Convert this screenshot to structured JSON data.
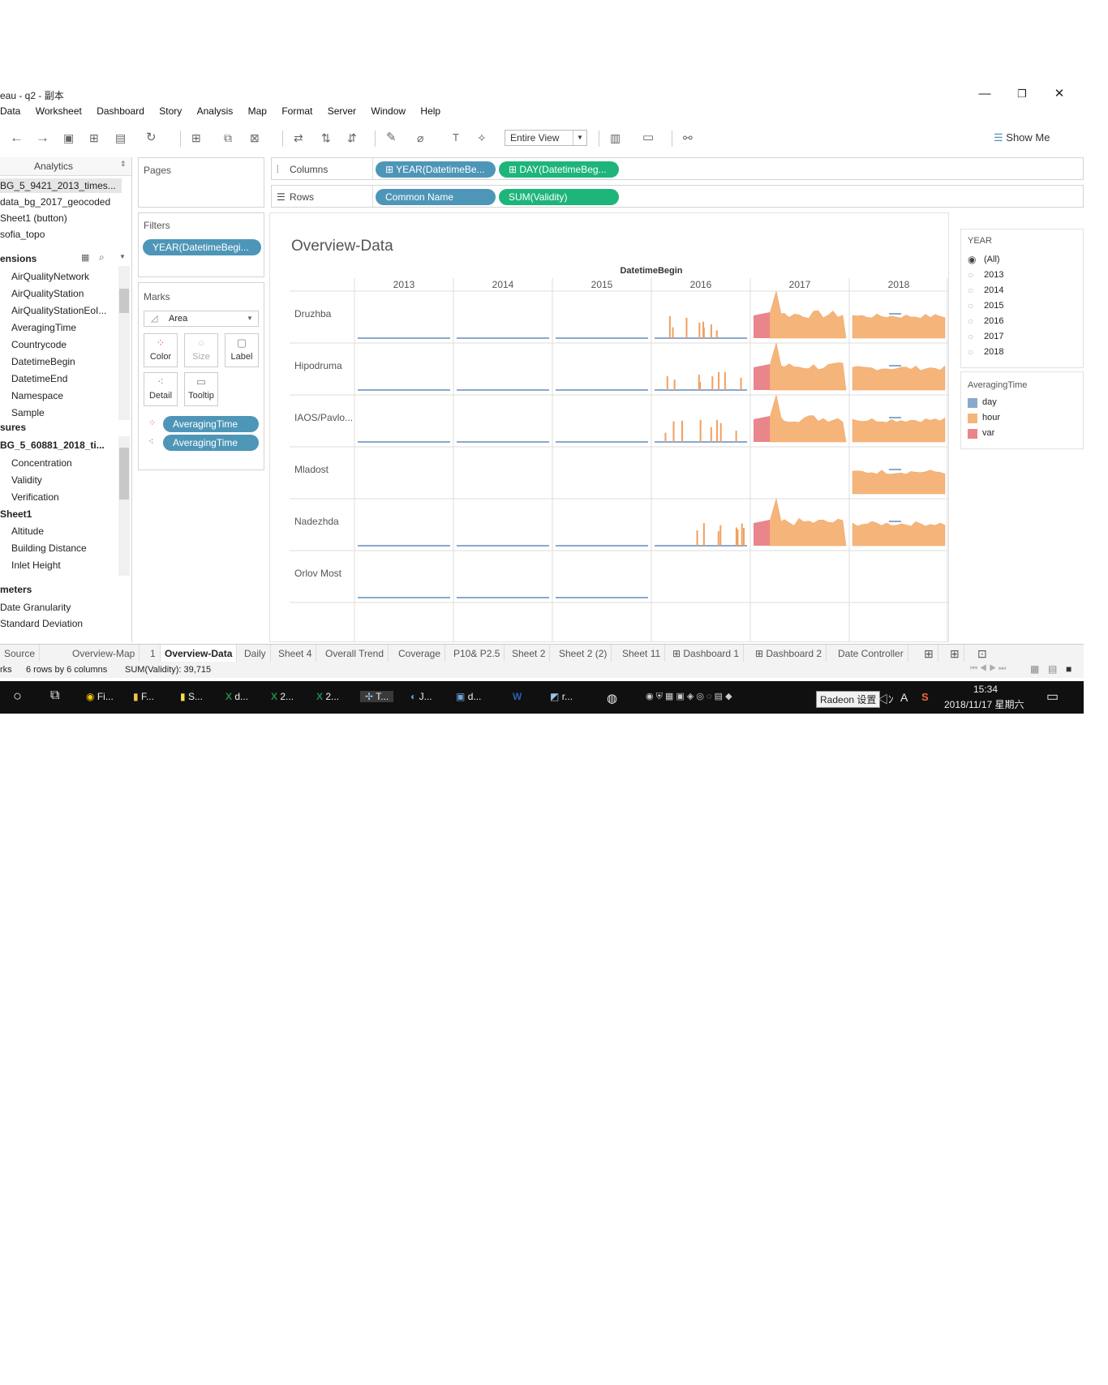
{
  "window": {
    "title": "eau - q2 - 副本",
    "controls": [
      "—",
      "❐",
      "✕"
    ]
  },
  "menu": [
    "Data",
    "Worksheet",
    "Dashboard",
    "Story",
    "Analysis",
    "Map",
    "Format",
    "Server",
    "Window",
    "Help"
  ],
  "toolbar": {
    "fit_value": "Entire View",
    "show_me": "Show Me"
  },
  "data_pane": {
    "tab_label": "Analytics",
    "sources": [
      "BG_5_9421_2013_times...",
      "data_bg_2017_geocoded",
      "Sheet1 (button)",
      "sofia_topo"
    ],
    "dimensions_header": "ensions",
    "dimensions": [
      "AirQualityNetwork",
      "AirQualityStation",
      "AirQualityStationEoI...",
      "AveragingTime",
      "Countrycode",
      "DatetimeBegin",
      "DatetimeEnd",
      "Namespace",
      "Sample"
    ],
    "measures_header": "sures",
    "measure_group_1": "BG_5_60881_2018_ti...",
    "measures_1": [
      "Concentration",
      "Validity",
      "Verification"
    ],
    "measure_group_2": "Sheet1",
    "measures_2": [
      "Altitude",
      "Building Distance",
      "Inlet Height"
    ],
    "parameters_header": "meters",
    "parameters": [
      "Date Granularity",
      "Standard Deviation"
    ]
  },
  "cards": {
    "pages_label": "Pages",
    "filters_label": "Filters",
    "filter_pill": "YEAR(DatetimeBegi...",
    "marks_label": "Marks",
    "mark_type": "Area",
    "mark_buttons": [
      "Color",
      "Size",
      "Label",
      "Detail",
      "Tooltip"
    ],
    "mark_pills": [
      "AveragingTime",
      "AveragingTime"
    ]
  },
  "shelves": {
    "columns_label": "Columns",
    "rows_label": "Rows",
    "columns_pills": [
      "YEAR(DatetimeBe...",
      "DAY(DatetimeBeg..."
    ],
    "rows_pills": [
      "Common Name",
      "SUM(Validity)"
    ]
  },
  "viz": {
    "title": "Overview-Data",
    "column_header": "DatetimeBegin",
    "years": [
      "2013",
      "2014",
      "2015",
      "2016",
      "2017",
      "2018"
    ],
    "rows": [
      "Druzhba",
      "Hipodruma",
      "IAOS/Pavlo...",
      "Mladost",
      "Nadezhda",
      "Orlov Most"
    ]
  },
  "chart_data": {
    "type": "area",
    "title": "Overview-Data",
    "column_field": "DatetimeBegin",
    "columns": [
      "2013",
      "2014",
      "2015",
      "2016",
      "2017",
      "2018"
    ],
    "row_field": "Common Name",
    "rows": [
      "Druzhba",
      "Hipodruma",
      "IAOS/Pavlo...",
      "Mladost",
      "Nadezhda",
      "Orlov Most"
    ],
    "measure": "SUM(Validity)",
    "color_field": "AveragingTime",
    "series": [
      {
        "name": "day",
        "color": "#8aa9cc"
      },
      {
        "name": "hour",
        "color": "#f5b57a"
      },
      {
        "name": "var",
        "color": "#e8868c"
      }
    ],
    "presence": {
      "Druzhba": {
        "day": [
          "2013",
          "2014",
          "2015",
          "2016"
        ],
        "hour": [
          "2016",
          "2017",
          "2018"
        ],
        "var": [
          "2017"
        ]
      },
      "Hipodruma": {
        "day": [
          "2013",
          "2014",
          "2015",
          "2016"
        ],
        "hour": [
          "2016",
          "2017",
          "2018"
        ],
        "var": [
          "2017"
        ]
      },
      "IAOS/Pavlo...": {
        "day": [
          "2013",
          "2014",
          "2015",
          "2016"
        ],
        "hour": [
          "2016",
          "2017",
          "2018"
        ],
        "var": [
          "2017"
        ]
      },
      "Mladost": {
        "day": [],
        "hour": [
          "2018"
        ],
        "var": []
      },
      "Nadezhda": {
        "day": [
          "2013",
          "2014",
          "2015",
          "2016"
        ],
        "hour": [
          "2016",
          "2017",
          "2018"
        ],
        "var": [
          "2017"
        ]
      },
      "Orlov Most": {
        "day": [
          "2013",
          "2014",
          "2015"
        ],
        "hour": [],
        "var": []
      }
    }
  },
  "year_filter": {
    "title": "YEAR",
    "options": [
      "(All)",
      "2013",
      "2014",
      "2015",
      "2016",
      "2017",
      "2018"
    ],
    "selected": "(All)"
  },
  "color_legend": {
    "title": "AveragingTime",
    "items": [
      {
        "label": "day",
        "color": "#8aa9cc"
      },
      {
        "label": "hour",
        "color": "#f5b57a"
      },
      {
        "label": "var",
        "color": "#e8868c"
      }
    ]
  },
  "sheet_tabs": [
    "Source",
    "Overview-Map",
    "1",
    "Overview-Data",
    "Daily",
    "Sheet 4",
    "Overall Trend",
    "Coverage",
    "P10& P2.5",
    "Sheet 2",
    "Sheet 2 (2)",
    "Sheet 11",
    "Dashboard 1",
    "Dashboard 2",
    "Date Controller"
  ],
  "active_tab": "Overview-Data",
  "status": {
    "marks": "rks",
    "dims": "6 rows by 6 columns",
    "sum": "SUM(Validity): 39,715"
  },
  "taskbar": {
    "apps": [
      "Fi...",
      "F...",
      "S...",
      "d...",
      "2...",
      "2...",
      "T...",
      "J...",
      "d...",
      "r..."
    ],
    "tooltip": "Radeon 设置",
    "time": "15:34",
    "date": "2018/11/17 星期六"
  }
}
